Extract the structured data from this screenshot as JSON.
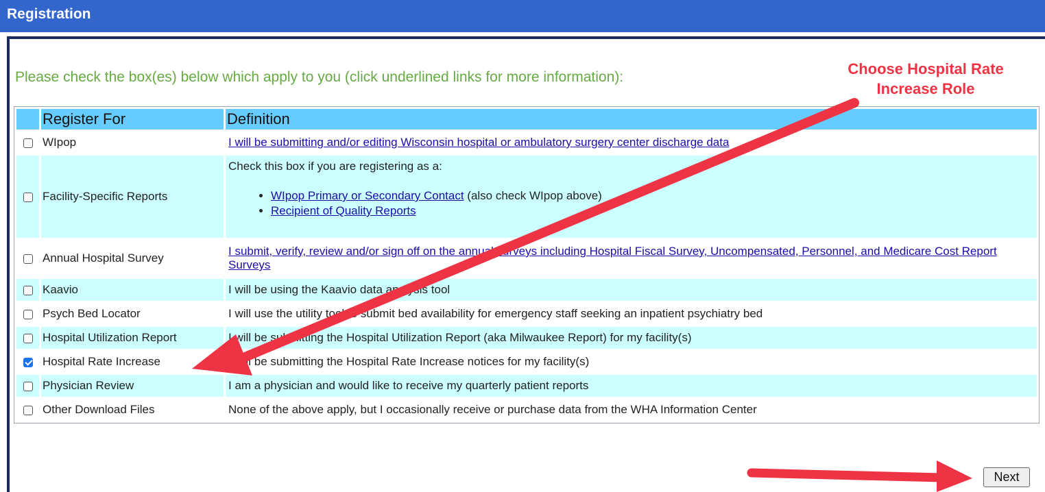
{
  "header": {
    "title": "Registration"
  },
  "instructions": "Please check the box(es) below which apply to you (click underlined links for more information):",
  "annotation": {
    "line1": "Choose Hospital Rate",
    "line2": "Increase Role",
    "color": "#ee3344"
  },
  "table": {
    "columns": [
      "Register For",
      "Definition"
    ],
    "rows": [
      {
        "name": "WIpop",
        "checked": false,
        "definition": "I will be submitting and/or editing Wisconsin hospital or ambulatory surgery center discharge data",
        "is_link": true
      },
      {
        "name": "Facility-Specific Reports",
        "checked": false,
        "definition_intro": "Check this box if you are registering as a:",
        "items": [
          {
            "link": "WIpop Primary or Secondary Contact",
            "suffix": " (also check WIpop above)"
          },
          {
            "link": "Recipient of Quality Reports",
            "suffix": ""
          }
        ]
      },
      {
        "name": "Annual Hospital Survey",
        "checked": false,
        "definition": "I submit, verify, review and/or sign off on the annual surveys including Hospital Fiscal Survey, Uncompensated, Personnel, and Medicare Cost Report Surveys",
        "is_link": true
      },
      {
        "name": "Kaavio",
        "checked": false,
        "definition": "I will be using the Kaavio data analysis tool"
      },
      {
        "name": "Psych Bed Locator",
        "checked": false,
        "definition": "I will use the utility tool to submit bed availability for emergency staff seeking an inpatient psychiatry bed"
      },
      {
        "name": "Hospital Utilization Report",
        "checked": false,
        "definition": "I will be submitting the Hospital Utilization Report (aka Milwaukee Report) for my facility(s)"
      },
      {
        "name": "Hospital Rate Increase",
        "checked": true,
        "definition": "I will be submitting the Hospital Rate Increase notices for my facility(s)"
      },
      {
        "name": "Physician Review",
        "checked": false,
        "definition": "I am a physician and would like to receive my quarterly patient reports"
      },
      {
        "name": "Other Download Files",
        "checked": false,
        "definition": "None of the above apply, but I occasionally receive or purchase data from the WHA Information Center"
      }
    ]
  },
  "next_button": {
    "label": "Next"
  },
  "colors": {
    "header_bg": "#3366cc",
    "table_header_bg": "#66ccff",
    "alt_row_bg": "#ccffff",
    "instructions_text": "#66aa44",
    "arrow": "#ee3344"
  }
}
